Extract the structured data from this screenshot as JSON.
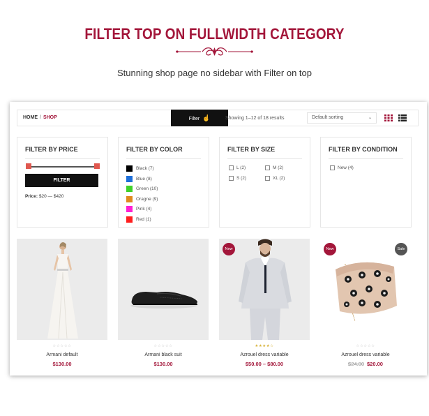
{
  "header": {
    "title": "FILTER TOP ON FULLWIDTH CATEGORY",
    "subtitle": "Stunning shop page no sidebar with Filter on top"
  },
  "toolbar": {
    "breadcrumb_home": "HOME",
    "breadcrumb_sep": "/",
    "breadcrumb_current": "SHOP",
    "filter_label": "Filter",
    "result_count": "Showing 1–12 of 18 results",
    "sorting": "Default sorting"
  },
  "filters": {
    "price": {
      "title": "FILTER BY PRICE",
      "button": "FILTER",
      "range_label": "Price:",
      "range_value": "$20 — $420"
    },
    "color": {
      "title": "FILTER BY COLOR",
      "items": [
        {
          "label": "Black (7)",
          "color": "#000000"
        },
        {
          "label": "Blue (8)",
          "color": "#1e6fd9"
        },
        {
          "label": "Green (10)",
          "color": "#3fd12a"
        },
        {
          "label": "Oragne (9)",
          "color": "#e08a1e"
        },
        {
          "label": "Pink (4)",
          "color": "#ff1fd2"
        },
        {
          "label": "Red (1)",
          "color": "#ff1e1e"
        }
      ]
    },
    "size": {
      "title": "FILTER BY SIZE",
      "items": [
        "L (2)",
        "M (2)",
        "S (2)",
        "XL (2)"
      ]
    },
    "condition": {
      "title": "FILTER BY CONDITION",
      "items": [
        "New (4)"
      ]
    }
  },
  "products": [
    {
      "name": "Armani default",
      "price": "$130.00",
      "stars": "☆☆☆☆☆",
      "badge_new": "",
      "badge_sale": ""
    },
    {
      "name": "Armani black suit",
      "price": "$130.00",
      "stars": "☆☆☆☆☆",
      "badge_new": "",
      "badge_sale": ""
    },
    {
      "name": "Azrouel dress variable",
      "price": "$50.00 – $80.00",
      "stars": "★★★★☆",
      "badge_new": "New",
      "badge_sale": ""
    },
    {
      "name": "Azrouel dress variable",
      "old_price": "$24.00",
      "price": "$20.00",
      "stars": "☆☆☆☆☆",
      "badge_new": "New",
      "badge_sale": "Sale"
    }
  ],
  "colors": {
    "accent": "#a3163a",
    "dark": "#111111"
  }
}
